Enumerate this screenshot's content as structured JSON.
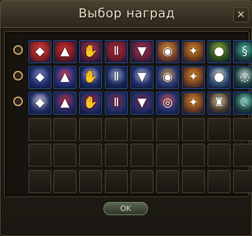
{
  "window": {
    "title": "Выбор наград",
    "close_glyph": "✕",
    "ok_label": "OK"
  },
  "colors": {
    "frame": "#5a4c33",
    "accent_gold": "#c9a86a",
    "item_border": "#2b4f96",
    "empty_slot_border": "#4d4330"
  },
  "reward_sets": [
    {
      "name": "set-1",
      "items": [
        {
          "name": "red-helmet-icon",
          "glyph": "◆",
          "bg": "#8a1f1f",
          "hi": "#d44"
        },
        {
          "name": "red-chest-armor-icon",
          "glyph": "▲",
          "bg": "#7a1a22",
          "hi": "#c33"
        },
        {
          "name": "red-gloves-icon",
          "glyph": "✋",
          "bg": "#5a1f3a",
          "hi": "#b3405f"
        },
        {
          "name": "red-leggings-icon",
          "glyph": "Ⅱ",
          "bg": "#6b1c2c",
          "hi": "#b02a45"
        },
        {
          "name": "red-boots-icon",
          "glyph": "▼",
          "bg": "#5c2038",
          "hi": "#a8385f"
        },
        {
          "name": "gold-shoulder-icon",
          "glyph": "◉",
          "bg": "#7a3f2a",
          "hi": "#e0a43a"
        },
        {
          "name": "winged-belt-icon",
          "glyph": "✦",
          "bg": "#6e3d1e",
          "hi": "#e08d2b"
        },
        {
          "name": "green-orb-icon",
          "glyph": "●",
          "bg": "#2f4e1b",
          "hi": "#9fc34a"
        },
        {
          "name": "teal-necklace-icon",
          "glyph": "§",
          "bg": "#1b3f3c",
          "hi": "#4cc9b7"
        }
      ]
    },
    {
      "name": "set-2",
      "items": [
        {
          "name": "blue-helmet-icon",
          "glyph": "◆",
          "bg": "#1f2f6e",
          "hi": "#8a8fc9"
        },
        {
          "name": "blue-chest-armor-icon",
          "glyph": "▲",
          "bg": "#25307a",
          "hi": "#d04a5a"
        },
        {
          "name": "blue-gloves-icon",
          "glyph": "✋",
          "bg": "#1f2c66",
          "hi": "#c9cfe0"
        },
        {
          "name": "blue-leggings-icon",
          "glyph": "Ⅱ",
          "bg": "#1c2b5e",
          "hi": "#9aa6d6"
        },
        {
          "name": "blue-boots-icon",
          "glyph": "▼",
          "bg": "#22306a",
          "hi": "#b6bcd8"
        },
        {
          "name": "gold-shoulder-icon",
          "glyph": "◉",
          "bg": "#2c3a7a",
          "hi": "#e0a43a"
        },
        {
          "name": "winged-belt-icon",
          "glyph": "✦",
          "bg": "#6e3d1e",
          "hi": "#e08d2b"
        },
        {
          "name": "white-orb-icon",
          "glyph": "●",
          "bg": "#304a6e",
          "hi": "#e8e8e0"
        },
        {
          "name": "silver-necklace-icon",
          "glyph": "◌",
          "bg": "#1b3f3c",
          "hi": "#cfe0dc"
        }
      ]
    },
    {
      "name": "set-3",
      "items": [
        {
          "name": "cloth-hood-icon",
          "glyph": "◆",
          "bg": "#26306a",
          "hi": "#d9d9e0"
        },
        {
          "name": "cloth-robe-icon",
          "glyph": "▲",
          "bg": "#2a2a66",
          "hi": "#b8323f"
        },
        {
          "name": "cloth-gloves-icon",
          "glyph": "✋",
          "bg": "#2a2c66",
          "hi": "#9a2a40"
        },
        {
          "name": "cloth-pants-icon",
          "glyph": "Ⅱ",
          "bg": "#24306a",
          "hi": "#8e2240"
        },
        {
          "name": "cloth-shoes-icon",
          "glyph": "▼",
          "bg": "#262e68",
          "hi": "#7d2a4a"
        },
        {
          "name": "red-bracelet-icon",
          "glyph": "◎",
          "bg": "#25306e",
          "hi": "#e05a5a"
        },
        {
          "name": "winged-belt-icon",
          "glyph": "✦",
          "bg": "#6e3d1e",
          "hi": "#e08d2b"
        },
        {
          "name": "idol-figure-icon",
          "glyph": "♜",
          "bg": "#4a3a2a",
          "hi": "#e6d4b0"
        },
        {
          "name": "crescent-charm-icon",
          "glyph": "☾",
          "bg": "#1b3f3c",
          "hi": "#7fe0c8"
        }
      ]
    }
  ],
  "empty_rows": 3,
  "columns": 9
}
